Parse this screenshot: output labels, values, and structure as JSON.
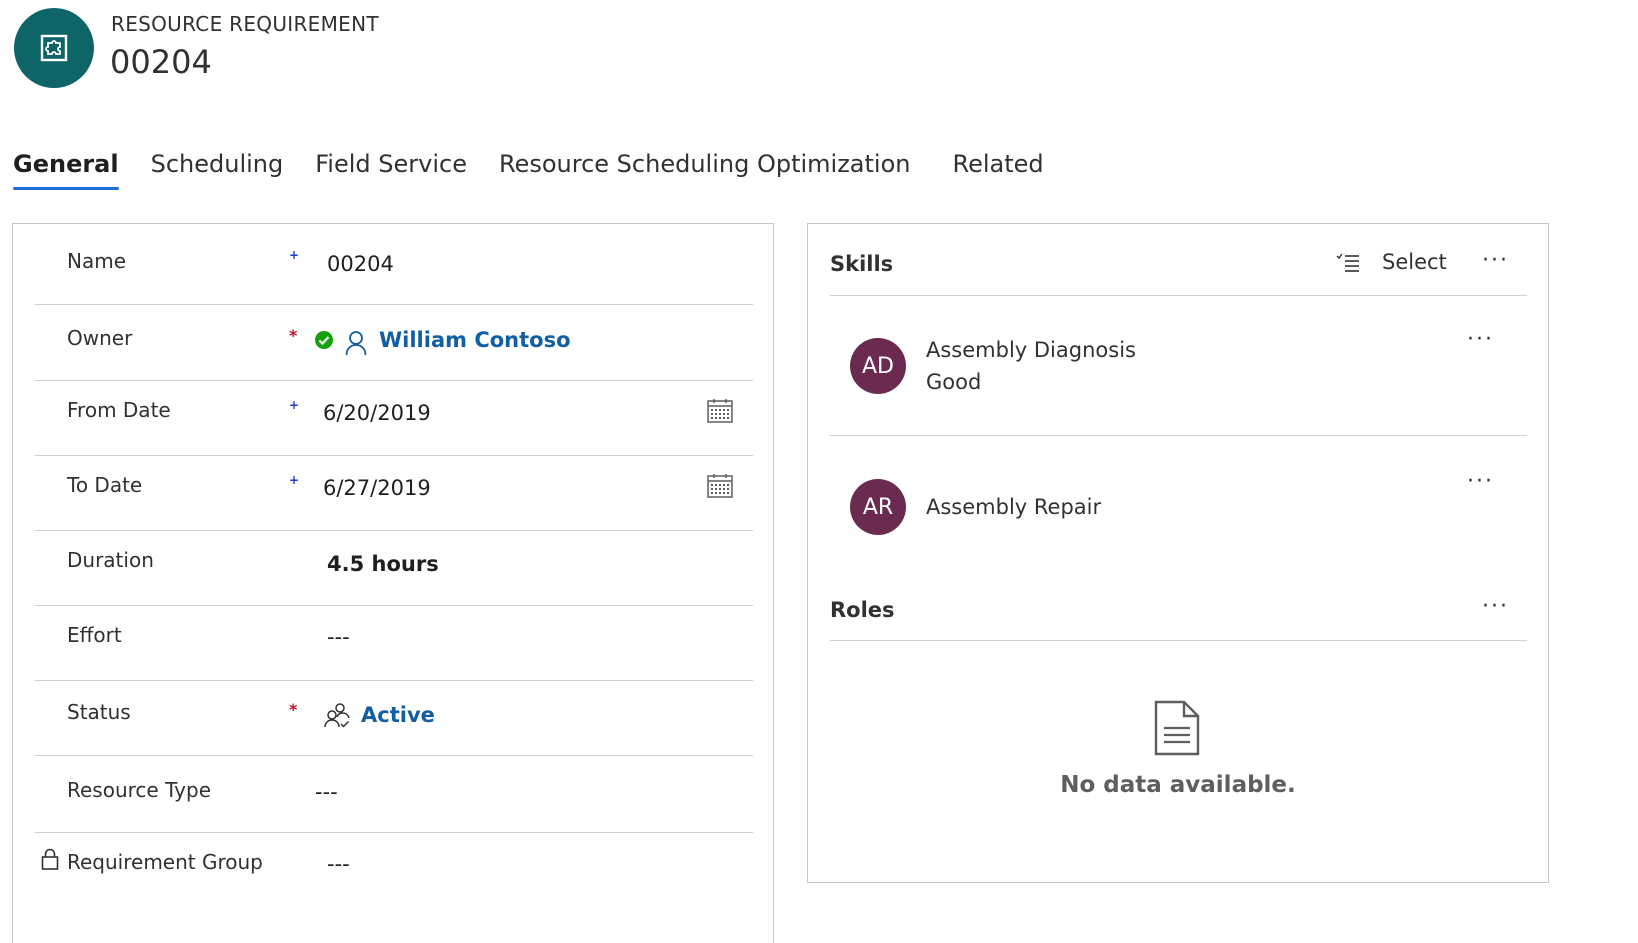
{
  "header": {
    "entity_type": "RESOURCE REQUIREMENT",
    "title": "00204",
    "icon": "puzzle-icon"
  },
  "tabs": [
    {
      "label": "General",
      "active": true
    },
    {
      "label": "Scheduling",
      "active": false
    },
    {
      "label": "Field Service",
      "active": false
    },
    {
      "label": "Resource Scheduling Optimization",
      "active": false
    },
    {
      "label": "Related",
      "active": false
    }
  ],
  "general": {
    "name": {
      "label": "Name",
      "required": "+",
      "value": "00204"
    },
    "owner": {
      "label": "Owner",
      "required": "*",
      "value": "William Contoso",
      "presence": "available"
    },
    "from_date": {
      "label": "From Date",
      "required": "+",
      "value": "6/20/2019"
    },
    "to_date": {
      "label": "To Date",
      "required": "+",
      "value": "6/27/2019"
    },
    "duration": {
      "label": "Duration",
      "value": "4.5 hours"
    },
    "effort": {
      "label": "Effort",
      "value": "---"
    },
    "status": {
      "label": "Status",
      "required": "*",
      "value": "Active"
    },
    "resource_type": {
      "label": "Resource Type",
      "value": "---"
    },
    "requirement_group": {
      "label": "Requirement Group",
      "value": "---",
      "locked": true
    }
  },
  "skills": {
    "title": "Skills",
    "select_label": "Select",
    "more": "···",
    "items": [
      {
        "initials": "AD",
        "name": "Assembly Diagnosis",
        "level": "Good",
        "more": "···"
      },
      {
        "initials": "AR",
        "name": "Assembly Repair",
        "level": "",
        "more": "···"
      }
    ]
  },
  "roles": {
    "title": "Roles",
    "more": "···",
    "empty_text": "No data available."
  },
  "colors": {
    "record_icon_bg": "#0e6568",
    "avatar_bg": "#6b2a4f",
    "link": "#115ea3",
    "tab_underline": "#1e6fd9",
    "required_red": "#c50f1f",
    "recommended_blue": "#1e3fc9",
    "presence_available": "#13a10e"
  }
}
